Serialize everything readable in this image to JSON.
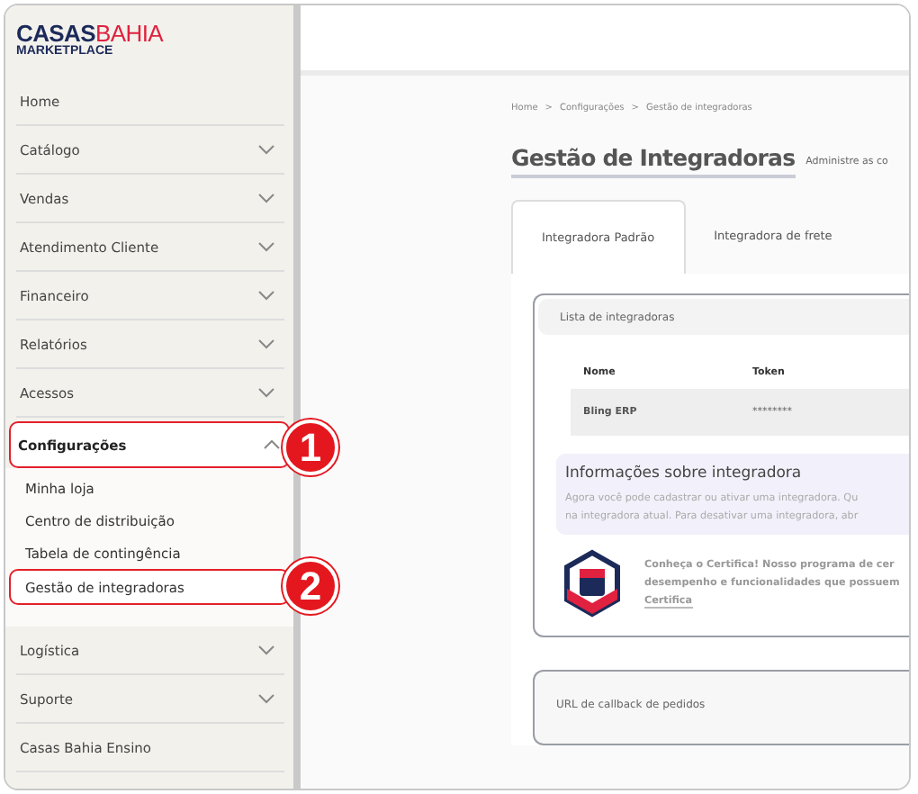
{
  "logo": {
    "brand_left": "CASAS",
    "brand_right": "BAHIA",
    "subtitle": "MARKETPLACE"
  },
  "sidebar": {
    "items": [
      {
        "label": "Home",
        "expandable": false,
        "expanded": false,
        "highlighted": false
      },
      {
        "label": "Catálogo",
        "expandable": true,
        "expanded": false,
        "highlighted": false
      },
      {
        "label": "Vendas",
        "expandable": true,
        "expanded": false,
        "highlighted": false
      },
      {
        "label": "Atendimento Cliente",
        "expandable": true,
        "expanded": false,
        "highlighted": false
      },
      {
        "label": "Financeiro",
        "expandable": true,
        "expanded": false,
        "highlighted": false
      },
      {
        "label": "Relatórios",
        "expandable": true,
        "expanded": false,
        "highlighted": false
      },
      {
        "label": "Acessos",
        "expandable": true,
        "expanded": false,
        "highlighted": false
      },
      {
        "label": "Configurações",
        "expandable": true,
        "expanded": true,
        "highlighted": true,
        "callout": "1",
        "children": [
          {
            "label": "Minha loja",
            "highlighted": false
          },
          {
            "label": "Centro de distribuição",
            "highlighted": false
          },
          {
            "label": "Tabela de contingência",
            "highlighted": false
          },
          {
            "label": "Gestão de integradoras",
            "highlighted": true,
            "callout": "2"
          }
        ]
      },
      {
        "label": "Logística",
        "expandable": true,
        "expanded": false,
        "highlighted": false
      },
      {
        "label": "Suporte",
        "expandable": true,
        "expanded": false,
        "highlighted": false
      },
      {
        "label": "Casas Bahia Ensino",
        "expandable": false,
        "expanded": false,
        "highlighted": false
      }
    ]
  },
  "breadcrumb": {
    "separator": ">",
    "items": [
      "Home",
      "Configurações",
      "Gestão de integradoras"
    ]
  },
  "page": {
    "title": "Gestão de Integradoras",
    "subtitle": "Administre as co"
  },
  "tabs": [
    {
      "label": "Integradora Padrão",
      "selected": true
    },
    {
      "label": "Integradora de frete",
      "selected": false
    }
  ],
  "integrators_card": {
    "title": "Lista de integradoras",
    "table": {
      "columns": [
        "Nome",
        "Token"
      ],
      "rows": [
        [
          "Bling ERP",
          "********"
        ]
      ]
    },
    "info": {
      "title": "Informações sobre integradora",
      "lines": [
        "Agora você pode cadastrar ou ativar uma integradora. Qu",
        "na integradora atual. Para desativar uma integradora, abr"
      ]
    },
    "certifica": {
      "lines": [
        "Conheça o Certifica! Nosso programa de cer",
        "desempenho e funcionalidades que possuem"
      ],
      "link": "Certifica"
    }
  },
  "callback_card": {
    "title": "URL de callback de pedidos"
  }
}
